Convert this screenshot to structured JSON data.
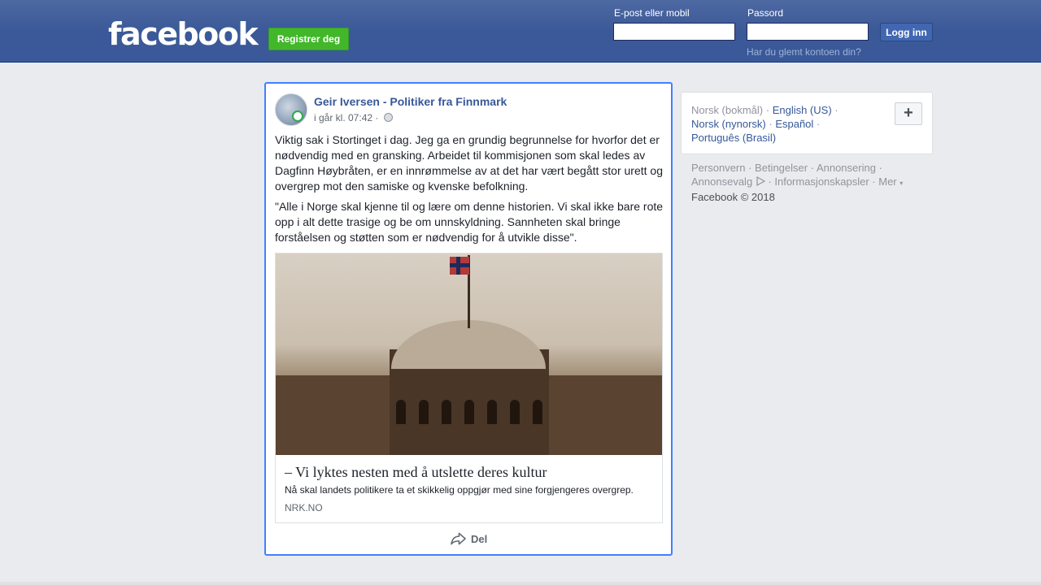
{
  "header": {
    "logo": "facebook",
    "register_label": "Registrer deg",
    "email_label": "E-post eller mobil",
    "email_value": "",
    "password_label": "Passord",
    "password_value": "",
    "login_label": "Logg inn",
    "forgot_label": "Har du glemt kontoen din?"
  },
  "post": {
    "author": "Geir Iversen - Politiker fra Finnmark",
    "time": "i går kl. 07:42 ·",
    "privacy_icon": "globe-icon",
    "paragraphs": [
      "Viktig sak i Stortinget i dag. Jeg ga en grundig begrunnelse for hvorfor det er nødvendig med en gransking. Arbeidet til kommisjonen som skal ledes av Dagfinn Høybråten, er en innrømmelse av at det har vært begått stor urett og overgrep mot den samiske og kvenske befolkning.",
      "\"Alle i Norge skal kjenne til og lære om denne historien. Vi skal ikke bare rote opp i alt dette trasige og be om unnskyldning. Sannheten skal bringe forståelsen og støtten som er nødvendig for å utvikle disse\"."
    ],
    "link": {
      "title": "– Vi lyktes nesten med å utslette deres kultur",
      "description": "Nå skal landets politikere ta et skikkelig oppgjør med sine forgjengeres overgrep.",
      "domain": "NRK.NO"
    },
    "share_label": "Del"
  },
  "sidebar": {
    "languages": {
      "current": "Norsk (bokmål)",
      "others": [
        "English (US)",
        "Norsk (nynorsk)",
        "Español",
        "Português (Brasil)"
      ],
      "more_label": "+"
    },
    "footer_links": [
      "Personvern",
      "Betingelser",
      "Annonsering",
      "Annonsevalg",
      "Informasjonskapsler",
      "Mer"
    ],
    "copyright": "Facebook © 2018"
  }
}
